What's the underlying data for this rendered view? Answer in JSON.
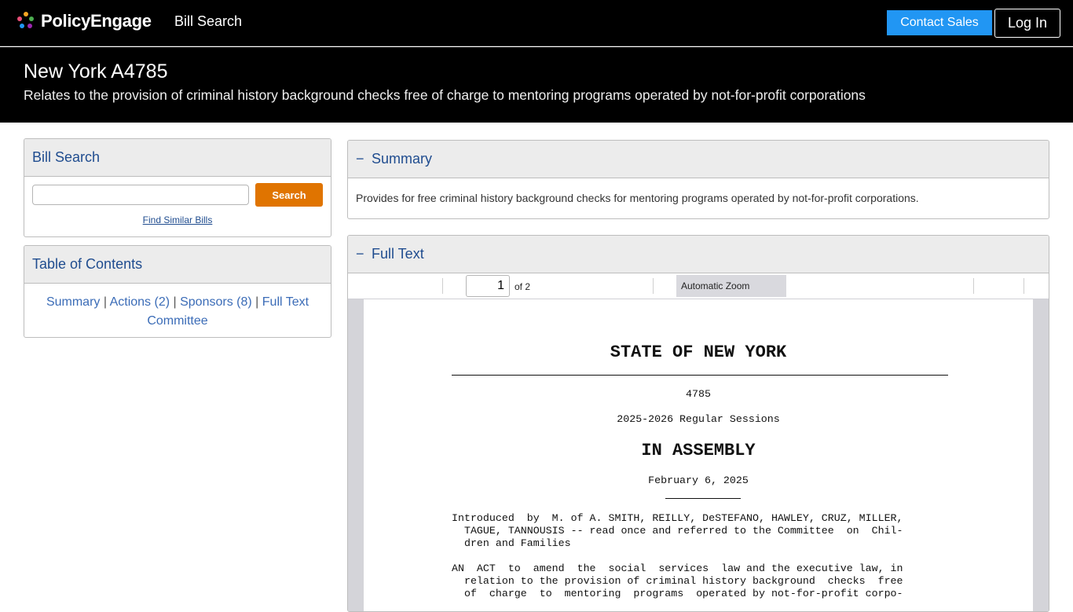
{
  "nav": {
    "brand": "PolicyEngage",
    "bill_search_link": "Bill Search",
    "contact_sales": "Contact Sales",
    "login": "Log In"
  },
  "bill": {
    "title": "New York A4785",
    "subtitle": "Relates to the provision of criminal history background checks free of charge to mentoring programs operated by not-for-profit corporations"
  },
  "search_card": {
    "title": "Bill Search",
    "input_value": "",
    "button": "Search",
    "similar_link": "Find Similar Bills"
  },
  "toc": {
    "title": "Table of Contents",
    "links": [
      "Summary",
      "Actions (2)",
      "Sponsors (8)",
      "Full Text",
      "Committee"
    ],
    "separator": "|"
  },
  "summary": {
    "toggle": "−",
    "title": "Summary",
    "text": "Provides for free criminal history background checks for mentoring programs operated by not-for-profit corporations."
  },
  "full_text": {
    "toggle": "−",
    "title": "Full Text",
    "toolbar": {
      "page_value": "1",
      "of_pages": "of 2",
      "zoom": "Automatic Zoom"
    },
    "document": {
      "state": "STATE OF NEW YORK",
      "number": "4785",
      "session": "2025-2026 Regular Sessions",
      "chamber": "IN ASSEMBLY",
      "date": "February 6, 2025",
      "intro_lines": [
        "Introduced  by  M. of A. SMITH, REILLY, DeSTEFANO, HAWLEY, CRUZ, MILLER,",
        "  TAGUE, TANNOUSIS -- read once and referred to the Committee  on  Chil-",
        "  dren and Families"
      ],
      "act_lines": [
        "AN  ACT  to  amend  the  social  services  law and the executive law, in",
        "  relation to the provision of criminal history background  checks  free",
        "  of  charge  to  mentoring  programs  operated by not-for-profit corpo-"
      ]
    }
  },
  "colors": {
    "header_bg": "#000000",
    "accent_blue": "#2196f3",
    "search_orange": "#e07400",
    "link_blue": "#1f4c8f"
  }
}
